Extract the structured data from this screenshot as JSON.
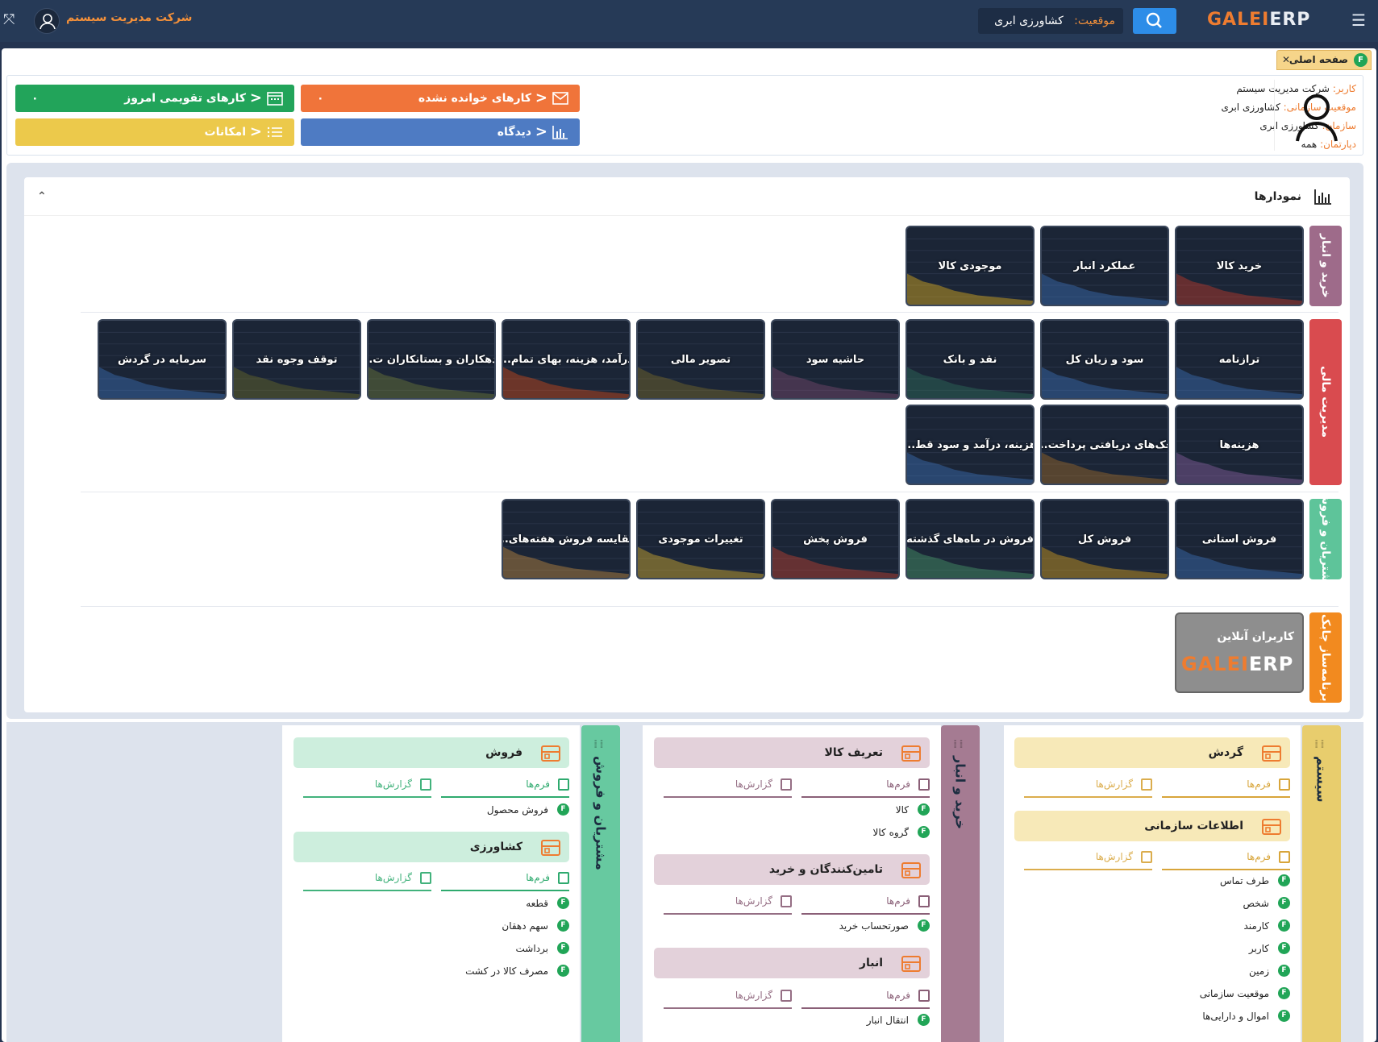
{
  "topbar": {
    "logo_a": "GALEI",
    "logo_b": "ERP",
    "location_label": "موقعیت:",
    "location_value": "کشاورزی ابری",
    "company": "شرکت مدیریت سیستم"
  },
  "tab": {
    "label": "صفحه اصلی",
    "badge": "F"
  },
  "user": {
    "user_k": "کاربر:",
    "user_v": "شرکت مدیریت سیستم",
    "pos_k": "موقعیت سازمانی:",
    "pos_v": "کشاورزی ابری",
    "org_k": "سازمان:",
    "org_v": "کشاورزی ابری",
    "dept_k": "دپارتمان:",
    "dept_v": "همه"
  },
  "quick": {
    "unread": {
      "label": "کارهای خوانده نشده",
      "count": "۰",
      "color": "#f0743a"
    },
    "calendar": {
      "label": "کارهای تقویمی امروز",
      "count": "۰",
      "color": "#22a45a"
    },
    "dashboard": {
      "label": "دیدگاه",
      "color": "#4e7bc3"
    },
    "features": {
      "label": "امکانات",
      "color": "#ecc94b"
    }
  },
  "charts": {
    "title": "نمودارها",
    "groups": [
      {
        "label": "خرید و انبار",
        "color": "#9e6b8a"
      },
      {
        "label": "مدیریت مالی",
        "color": "#d94b4f"
      },
      {
        "label": "مشتریان و فروش",
        "color": "#5ec49a"
      },
      {
        "label": "برنامه‌ساز چابک",
        "color": "#f28a1f"
      }
    ],
    "tiles": [
      "خرید کالا",
      "عملکرد انبار",
      "موجودی کالا",
      "ترازنامه",
      "سود و زیان کل",
      "نقد و بانک",
      "حاشیه سود",
      "تصویر مالی",
      "درآمد، هزینه، بهای تمام...",
      "بدهکاران و بستانکاران ت...",
      "توقف وجوه نقد",
      "سرمایه در گردش",
      "هزینه‌ها",
      "چک‌های دریافتی پرداخت...",
      "هزینه، درآمد و سود قط...",
      "فروش استانی",
      "فروش کل",
      "فروش در ماه‌های گذشته",
      "فروش پخش",
      "تغییرات موجودی",
      "مقایسه فروش هفته‌های..."
    ],
    "online": {
      "label": "کاربران آنلاین",
      "logo_a": "GALEI",
      "logo_b": "ERP"
    }
  },
  "modules": {
    "forms": "فرم‌ها",
    "reports": "گزارش‌ها",
    "system": {
      "title": "سیستم",
      "sections": [
        {
          "title": "گردش"
        },
        {
          "title": "اطلاعات سازمانی"
        }
      ],
      "items": [
        "طرف تماس",
        "شخص",
        "کارمند",
        "کاربر",
        "زمین",
        "موقعیت سازمانی",
        "اموال و دارایی‌ها"
      ],
      "color": "#e8cd6d",
      "sec_bg": "#f7e9b8"
    },
    "purchase": {
      "title": "خرید و انبار",
      "sections": [
        {
          "title": "تعریف کالا",
          "items": [
            "کالا",
            "گروه کالا"
          ]
        },
        {
          "title": "تامین‌کنندگان و خرید",
          "items": [
            "صورتحساب خرید"
          ]
        },
        {
          "title": "انبار",
          "items": [
            "انتقال انبار"
          ]
        }
      ],
      "color": "#a57b92",
      "sec_bg": "#e3d1da"
    },
    "sales": {
      "title": "مشتریان و فروش",
      "sections": [
        {
          "title": "فروش",
          "items": [
            "فروش محصول"
          ]
        },
        {
          "title": "کشاورزی",
          "items": [
            "قطعه",
            "سهم دهقان",
            "برداشت",
            "مصرف کالا در کشت"
          ]
        }
      ],
      "color": "#67c9a0",
      "sec_bg": "#cdeedd"
    }
  }
}
